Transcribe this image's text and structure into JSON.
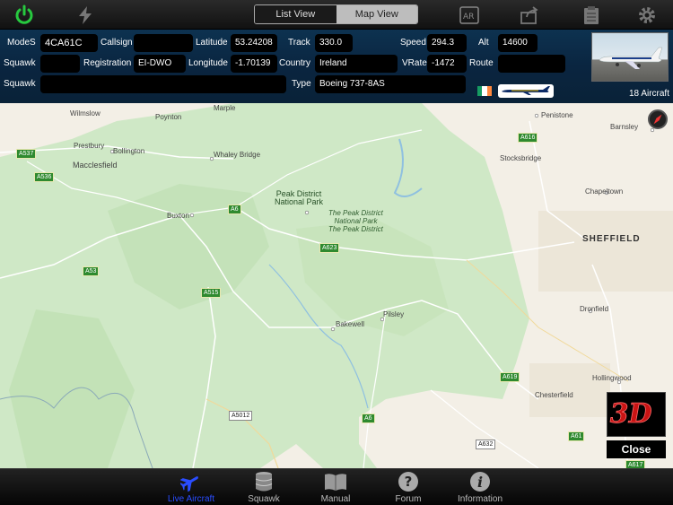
{
  "toolbar": {
    "segment_list": "List View",
    "segment_map": "Map View",
    "ar_label": "AR"
  },
  "info": {
    "labels": {
      "modes": "ModeS",
      "callsign": "Callsign",
      "latitude": "Latitude",
      "track": "Track",
      "speed": "Speed",
      "alt": "Alt",
      "squawk1": "Squawk",
      "registration": "Registration",
      "longitude": "Longitude",
      "country": "Country",
      "vrate": "VRate",
      "route": "Route",
      "squawk2": "Squawk",
      "type": "Type"
    },
    "values": {
      "modes": "4CA61C",
      "callsign": "",
      "latitude": "53.24208",
      "track": "330.0",
      "speed": "294.3",
      "alt": "14600",
      "squawk1": "",
      "registration": "EI-DWO",
      "longitude": "-1.70139",
      "country": "Ireland",
      "vrate": "-1472",
      "route": "",
      "squawk2": "",
      "type": "Boeing 737-8AS"
    },
    "aircraft_count": "18 Aircraft"
  },
  "map": {
    "towns": {
      "wilmslow": "Wilmslow",
      "poynton": "Poynton",
      "marple": "Marple",
      "penistone": "Penistone",
      "barnsley": "Barnsley",
      "prestbury": "Prestbury",
      "bollington": "Bollington",
      "macclesfield": "Macclesfield",
      "whaley": "Whaley Bridge",
      "stocksbridge": "Stocksbridge",
      "chapeltown": "Chapeltown",
      "buxton": "Buxton",
      "sheffield": "SHEFFIELD",
      "pilsley": "Pilsley",
      "bakewell": "Bakewell",
      "dronfield": "Dronfield",
      "hollingwood": "Hollingwood",
      "chesterfield": "Chesterfield"
    },
    "park_main": "Peak District\nNational Park",
    "park_sub": "The Peak District\nNational Park\nThe Peak District",
    "roads": {
      "a537": "A537",
      "a536": "A536",
      "a53": "A53",
      "a515": "A515",
      "a6": "A6",
      "a623": "A623",
      "a616": "A616",
      "a619": "A619",
      "a5012": "A5012",
      "a6b": "A6",
      "a632": "A632",
      "a61": "A61",
      "a617": "A617"
    },
    "close_label": "Close",
    "btn3d_label": "3D"
  },
  "tabs": [
    {
      "label": "Live Aircraft"
    },
    {
      "label": "Squawk"
    },
    {
      "label": "Manual"
    },
    {
      "label": "Forum"
    },
    {
      "label": "Information"
    }
  ],
  "colors": {
    "power_green": "#27c93f",
    "active_tab": "#2a4dff",
    "park_green": "#c8e6be",
    "road_green": "#2f8a2f"
  }
}
